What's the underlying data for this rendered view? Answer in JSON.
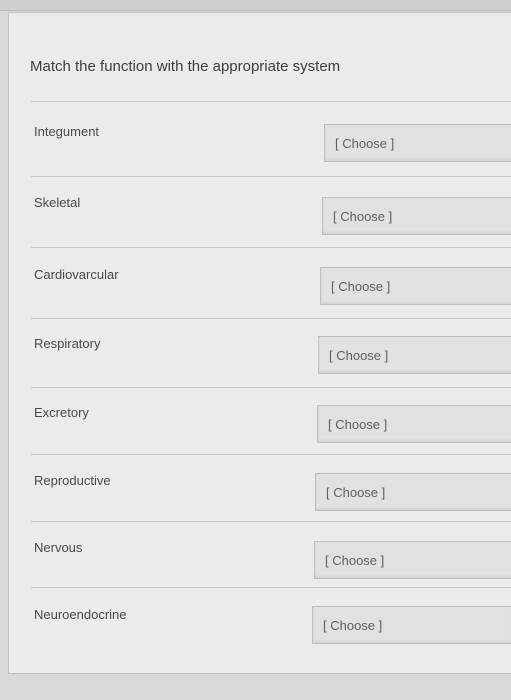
{
  "question": {
    "prompt": "Match the function with the appropriate system"
  },
  "rows": [
    {
      "label": "Integument",
      "selected": "[ Choose ]"
    },
    {
      "label": "Skeletal",
      "selected": "[ Choose ]"
    },
    {
      "label": "Cardiovarcular",
      "selected": "[ Choose ]"
    },
    {
      "label": "Respiratory",
      "selected": "[ Choose ]"
    },
    {
      "label": "Excretory",
      "selected": "[ Choose ]"
    },
    {
      "label": "Reproductive",
      "selected": "[ Choose ]"
    },
    {
      "label": "Nervous",
      "selected": "[ Choose ]"
    },
    {
      "label": "Neuroendocrine",
      "selected": "[ Choose ]"
    }
  ]
}
